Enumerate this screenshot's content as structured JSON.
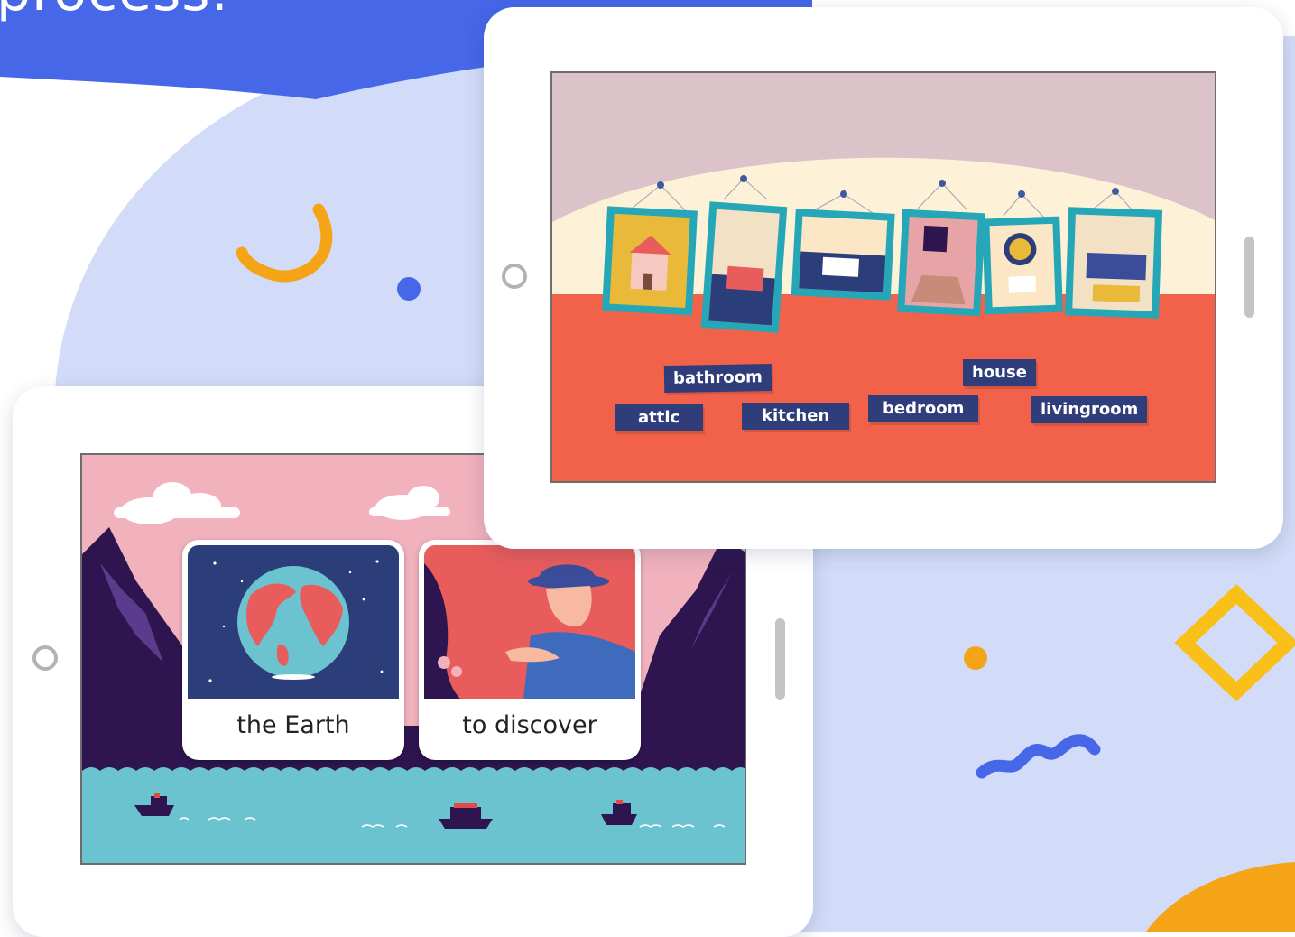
{
  "headline": "process.",
  "tablet_back": {
    "scene": "house-rooms",
    "rooms": [
      "house-picture",
      "bedroom-picture",
      "kitchen-picture",
      "attic-picture",
      "bathroom-picture",
      "livingroom-picture"
    ],
    "labels": {
      "bathroom": "bathroom",
      "house": "house",
      "attic": "attic",
      "kitchen": "kitchen",
      "bedroom": "bedroom",
      "livingroom": "livingroom"
    }
  },
  "tablet_front": {
    "scene": "mountains-sea",
    "cards": [
      {
        "label": "the Earth",
        "icon": "earth-icon"
      },
      {
        "label": "to discover",
        "icon": "explorer-icon"
      }
    ]
  },
  "colors": {
    "blue_band": "#4567e8",
    "light_blob": "#d2dcf8",
    "orange": "#f5a417",
    "yellow": "#f9c01a",
    "wall_red": "#f2614a",
    "label_navy": "#2f3e7a",
    "sea": "#6bc3cf",
    "sky_pink": "#f1b2bd",
    "mountain": "#2e1550"
  }
}
